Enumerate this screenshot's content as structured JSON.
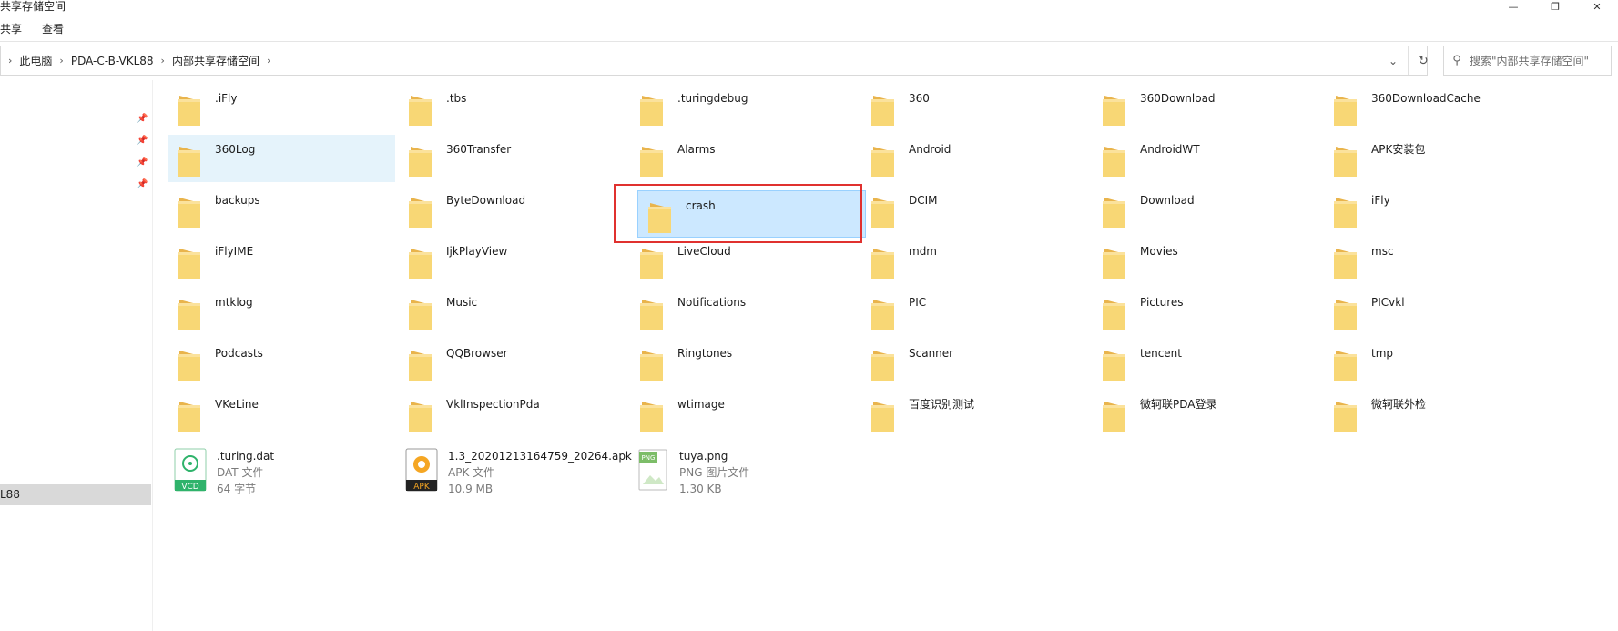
{
  "window": {
    "title": "共享存储空间"
  },
  "ribbon": {
    "tabs": [
      "共享",
      "查看"
    ]
  },
  "address": {
    "crumbs": [
      "此电脑",
      "PDA-C-B-VKL88",
      "内部共享存储空间"
    ],
    "search_placeholder": "搜索\"内部共享存储空间\""
  },
  "nav": {
    "selected_label": "L88"
  },
  "folders": [
    ".iFly",
    ".tbs",
    ".turingdebug",
    "360",
    "360Download",
    "360DownloadCache",
    "360Log",
    "360Transfer",
    "Alarms",
    "Android",
    "AndroidWT",
    "APK安装包",
    "backups",
    "ByteDownload",
    "crash",
    "DCIM",
    "Download",
    "iFly",
    "iFlyIME",
    "IjkPlayView",
    "LiveCloud",
    "mdm",
    "Movies",
    "msc",
    "mtklog",
    "Music",
    "Notifications",
    "PIC",
    "Pictures",
    "PICvkl",
    "Podcasts",
    "QQBrowser",
    "Ringtones",
    "Scanner",
    "tencent",
    "tmp",
    "VKeLine",
    "VklInspectionPda",
    "wtimage",
    "百度识别测试",
    "微轲联PDA登录",
    "微轲联外检"
  ],
  "files": [
    {
      "name": ".turing.dat",
      "type": "DAT 文件",
      "size": "64 字节",
      "badge": "VCD"
    },
    {
      "name": "1.3_20201213164759_20264.apk",
      "type": "APK 文件",
      "size": "10.9 MB",
      "badge": "APK"
    },
    {
      "name": "tuya.png",
      "type": "PNG 图片文件",
      "size": "1.30 KB",
      "badge": "PNG"
    }
  ],
  "colors": {
    "folder": "#f8d775",
    "selection": "#cce8ff",
    "highlight_box": "#e0312f"
  }
}
